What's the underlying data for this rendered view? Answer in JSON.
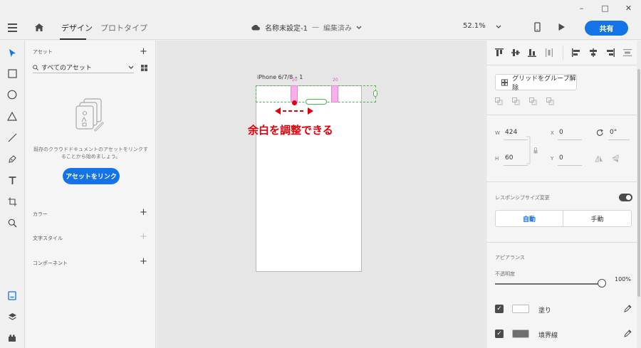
{
  "window_controls": {
    "minimize": "–",
    "maximize": "□",
    "close": "✕"
  },
  "header": {
    "tabs": [
      {
        "label": "デザイン",
        "active": true
      },
      {
        "label": "プロトタイプ",
        "active": false
      }
    ],
    "doc_title": "名称未設定-1",
    "doc_separator": "—",
    "doc_status": "編集済み",
    "zoom": "52.1%",
    "share_label": "共有",
    "accent_color": "#1473e6"
  },
  "toolbar": {
    "tools": [
      "select-icon",
      "rectangle-icon",
      "ellipse-icon",
      "polygon-icon",
      "line-icon",
      "pen-icon",
      "text-icon",
      "artboard-icon",
      "zoom-icon"
    ],
    "bottom": [
      "assets-panel-icon",
      "layers-icon",
      "plugins-icon"
    ]
  },
  "assets_panel": {
    "title": "アセット",
    "filter_label": "すべてのアセット",
    "empty_message": "既存のクラウドドキュメントのアセットをリンクすることから始めましょう。",
    "link_button": "アセットをリンク",
    "sections": [
      {
        "label": "カラー"
      },
      {
        "label": "文字スタイル"
      },
      {
        "label": "コンポーネント"
      }
    ]
  },
  "canvas": {
    "artboard_title": "iPhone 6/7/8 – 1",
    "spacing_labels": [
      "20",
      "20"
    ],
    "annotation": "余白を調整できる",
    "annotation_color": "#e3000b"
  },
  "props_panel": {
    "ungroup_label": "グリッドをグループ解除",
    "w_label": "W",
    "w_value": "424",
    "h_label": "H",
    "h_value": "60",
    "x_label": "X",
    "x_value": "0",
    "y_label": "Y",
    "y_value": "0",
    "rotation_value": "0°",
    "responsive_label": "レスポンシブサイズ変更",
    "responsive_on": true,
    "segment_auto": "自動",
    "segment_manual": "手動",
    "appearance_label": "アピアランス",
    "opacity_label": "不透明度",
    "opacity_value": "100%",
    "fill_label": "塗り",
    "fill_color": "#ffffff",
    "stroke_label": "境界線",
    "stroke_color": "#707070"
  }
}
